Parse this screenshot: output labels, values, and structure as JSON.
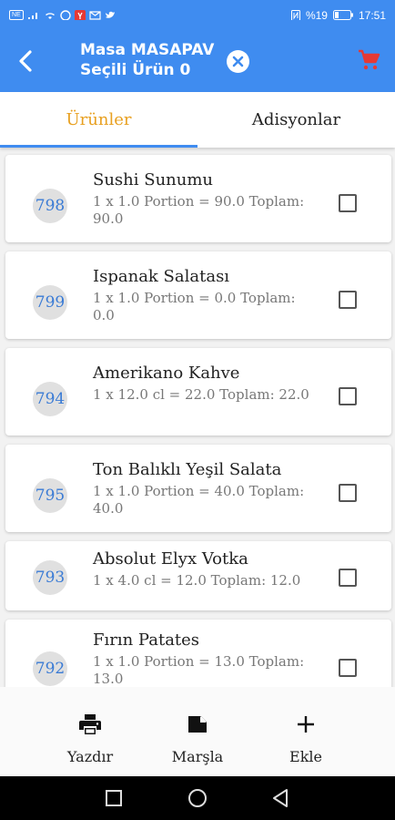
{
  "status_bar": {
    "left_badge": "NE",
    "battery_text": "%19",
    "time": "17:51"
  },
  "app_bar": {
    "title_line1": "Masa MASAPAV",
    "title_line2": "Seçili Ürün 0",
    "accent_color": "#3f8cf0",
    "cart_color": "#e53935"
  },
  "tabs": [
    {
      "label": "Ürünler",
      "active": true
    },
    {
      "label": "Adisyonlar",
      "active": false
    }
  ],
  "items": [
    {
      "code": "798",
      "name": "Sushi Sunumu",
      "detail": "1 x 1.0 Portion = 90.0 Toplam: 90.0",
      "checked": false
    },
    {
      "code": "799",
      "name": "Ispanak Salatası",
      "detail": "1 x 1.0 Portion = 0.0 Toplam: 0.0",
      "checked": false
    },
    {
      "code": "794",
      "name": "Amerikano Kahve",
      "detail": "1 x 12.0 cl = 22.0 Toplam: 22.0",
      "checked": false
    },
    {
      "code": "795",
      "name": "Ton Balıklı Yeşil Salata",
      "detail": "1 x 1.0 Portion = 40.0 Toplam: 40.0",
      "checked": false
    },
    {
      "code": "793",
      "name": "Absolut Elyx Votka",
      "detail": "1 x 4.0 cl = 12.0 Toplam: 12.0",
      "checked": false
    },
    {
      "code": "792",
      "name": "Fırın Patates",
      "detail": "1 x 1.0 Portion = 13.0 Toplam: 13.0",
      "checked": false
    }
  ],
  "actions": [
    {
      "label": "Yazdır",
      "icon": "printer-icon"
    },
    {
      "label": "Marşla",
      "icon": "send-icon"
    },
    {
      "label": "Ekle",
      "icon": "plus-icon"
    }
  ]
}
